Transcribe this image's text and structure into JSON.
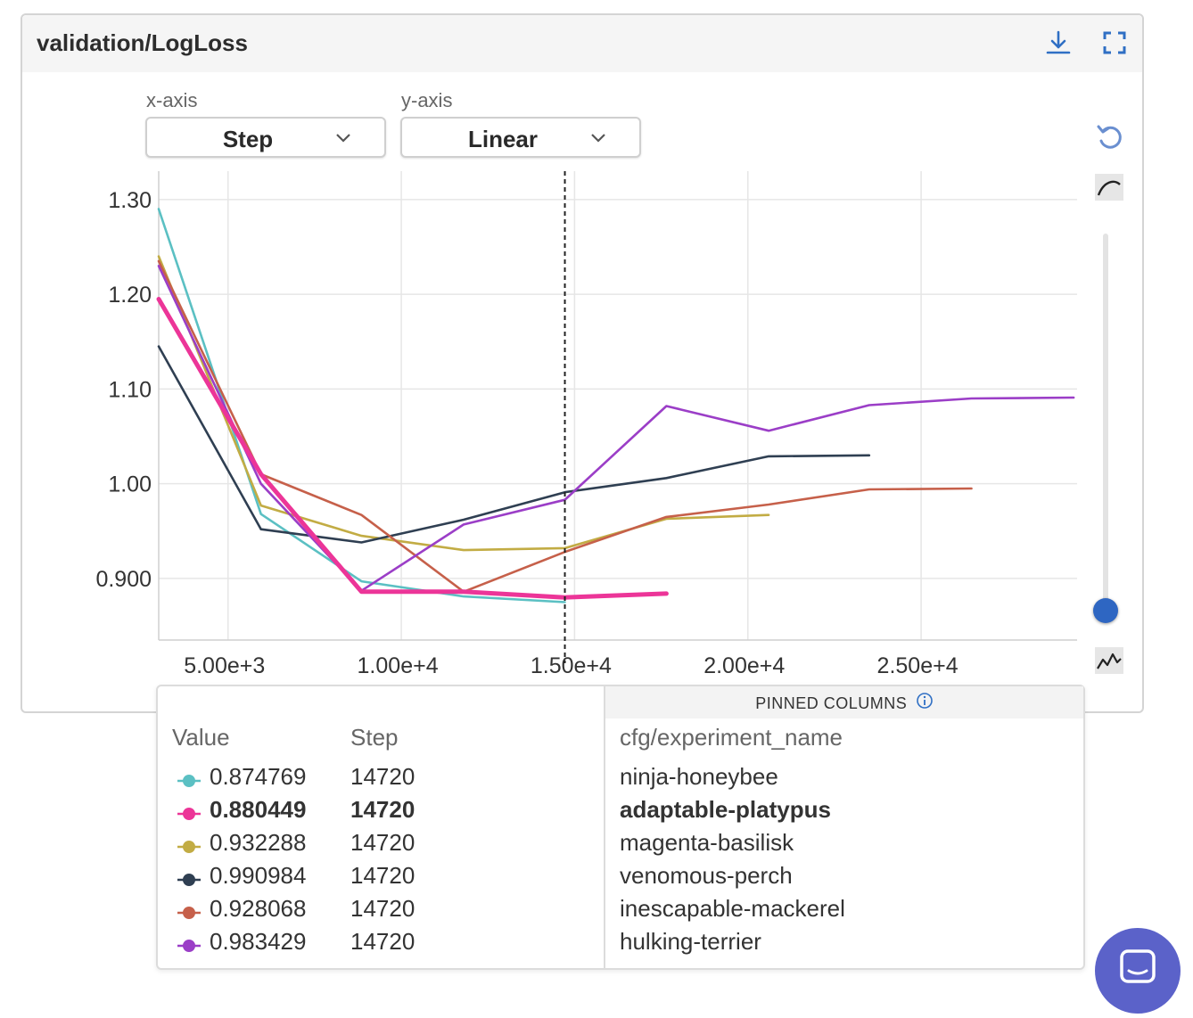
{
  "panel": {
    "title": "validation/LogLoss",
    "download_icon": "download-icon",
    "fullscreen_icon": "fullscreen-icon"
  },
  "controls": {
    "x_axis_label": "x-axis",
    "x_axis_value": "Step",
    "y_axis_label": "y-axis",
    "y_axis_value": "Linear",
    "reset_icon": "reset-icon",
    "smoothing_icon": "smooth-curve-icon",
    "raw_icon": "raw-line-icon",
    "smoothing_level": 0.0
  },
  "chart_data": {
    "type": "line",
    "title": "validation/LogLoss",
    "xlabel": "Step",
    "ylabel": "",
    "xlim": [
      3000,
      29500
    ],
    "ylim": [
      0.835,
      1.33
    ],
    "x_ticks": [
      5000,
      10000,
      15000,
      20000,
      25000
    ],
    "x_tick_labels": [
      "5.00e+3",
      "1.00e+4",
      "1.50e+4",
      "2.00e+4",
      "2.50e+4"
    ],
    "y_ticks": [
      0.9,
      1.0,
      1.1,
      1.2,
      1.3
    ],
    "y_tick_labels": [
      "0.900",
      "1.00",
      "1.10",
      "1.20",
      "1.30"
    ],
    "grid": true,
    "hover_x": 14720,
    "series": [
      {
        "name": "ninja-honeybee",
        "color": "#5bc0c3",
        "highlight": false,
        "x": [
          3000,
          5950,
          8850,
          11800,
          14720
        ],
        "y": [
          1.29,
          0.968,
          0.897,
          0.881,
          0.875
        ]
      },
      {
        "name": "adaptable-platypus",
        "color": "#ec3598",
        "highlight": true,
        "x": [
          3000,
          5950,
          8850,
          11800,
          14720,
          17650
        ],
        "y": [
          1.195,
          1.01,
          0.886,
          0.886,
          0.88,
          0.884
        ]
      },
      {
        "name": "magenta-basilisk",
        "color": "#c2ac44",
        "highlight": false,
        "x": [
          3000,
          5950,
          8850,
          11800,
          14720,
          17650,
          20600
        ],
        "y": [
          1.24,
          0.977,
          0.945,
          0.93,
          0.932,
          0.963,
          0.967
        ]
      },
      {
        "name": "venomous-perch",
        "color": "#2f3f52",
        "highlight": false,
        "x": [
          3000,
          5950,
          8850,
          11800,
          14720,
          17650,
          20600,
          23500
        ],
        "y": [
          1.145,
          0.952,
          0.938,
          0.962,
          0.991,
          1.006,
          1.029,
          1.03
        ]
      },
      {
        "name": "inescapable-mackerel",
        "color": "#c6604a",
        "highlight": false,
        "x": [
          3000,
          5950,
          8850,
          11800,
          14720,
          17650,
          20600,
          23500,
          26450
        ],
        "y": [
          1.235,
          1.01,
          0.967,
          0.886,
          0.928,
          0.965,
          0.978,
          0.994,
          0.995
        ]
      },
      {
        "name": "hulking-terrier",
        "color": "#9b3ec7",
        "highlight": false,
        "x": [
          3000,
          5950,
          8850,
          11800,
          14720,
          17650,
          20600,
          23500,
          26450,
          29400
        ],
        "y": [
          1.23,
          1.0,
          0.887,
          0.957,
          0.983,
          1.082,
          1.056,
          1.083,
          1.09,
          1.091
        ]
      }
    ]
  },
  "tooltip": {
    "pinned_header": "PINNED COLUMNS",
    "info_icon": "info-icon",
    "col_value": "Value",
    "col_step": "Step",
    "col_name": "cfg/experiment_name",
    "rows": [
      {
        "value": "0.874769",
        "step": "14720",
        "name": "ninja-honeybee",
        "color": "#5bc0c3",
        "bold": false
      },
      {
        "value": "0.880449",
        "step": "14720",
        "name": "adaptable-platypus",
        "color": "#ec3598",
        "bold": true
      },
      {
        "value": "0.932288",
        "step": "14720",
        "name": "magenta-basilisk",
        "color": "#c2ac44",
        "bold": false
      },
      {
        "value": "0.990984",
        "step": "14720",
        "name": "venomous-perch",
        "color": "#2f3f52",
        "bold": false
      },
      {
        "value": "0.928068",
        "step": "14720",
        "name": "inescapable-mackerel",
        "color": "#c6604a",
        "bold": false
      },
      {
        "value": "0.983429",
        "step": "14720",
        "name": "hulking-terrier",
        "color": "#9b3ec7",
        "bold": false
      }
    ]
  },
  "chat": {
    "icon": "chat-icon",
    "color": "#5b62c9"
  }
}
